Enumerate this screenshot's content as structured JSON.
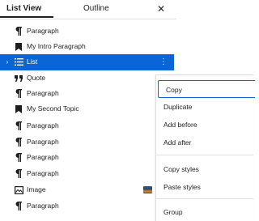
{
  "panel": {
    "tabs": [
      {
        "label": "List View"
      },
      {
        "label": "Outline"
      }
    ],
    "close_icon": "close-icon"
  },
  "list_items": [
    {
      "label": "Paragraph",
      "icon": "paragraph-icon"
    },
    {
      "label": "My Intro Paragraph",
      "icon": "bookmark-icon"
    },
    {
      "label": "List",
      "icon": "list-icon",
      "selected": true
    },
    {
      "label": "Quote",
      "icon": "quote-icon"
    },
    {
      "label": "Paragraph",
      "icon": "paragraph-icon"
    },
    {
      "label": "My Second Topic",
      "icon": "bookmark-icon"
    },
    {
      "label": "Paragraph",
      "icon": "paragraph-icon"
    },
    {
      "label": "Paragraph",
      "icon": "paragraph-icon"
    },
    {
      "label": "Paragraph",
      "icon": "paragraph-icon"
    },
    {
      "label": "Paragraph",
      "icon": "paragraph-icon"
    },
    {
      "label": "Image",
      "icon": "image-icon"
    },
    {
      "label": "Paragraph",
      "icon": "paragraph-icon"
    }
  ],
  "context_menu": {
    "items": [
      {
        "label": "Copy"
      },
      {
        "label": "Duplicate"
      },
      {
        "label": "Add before"
      },
      {
        "label": "Add after"
      },
      {
        "label": "Copy styles"
      },
      {
        "label": "Paste styles"
      },
      {
        "label": "Group"
      }
    ]
  },
  "colors": {
    "accent": "#0a66d6",
    "text": "#1e1e1e"
  }
}
